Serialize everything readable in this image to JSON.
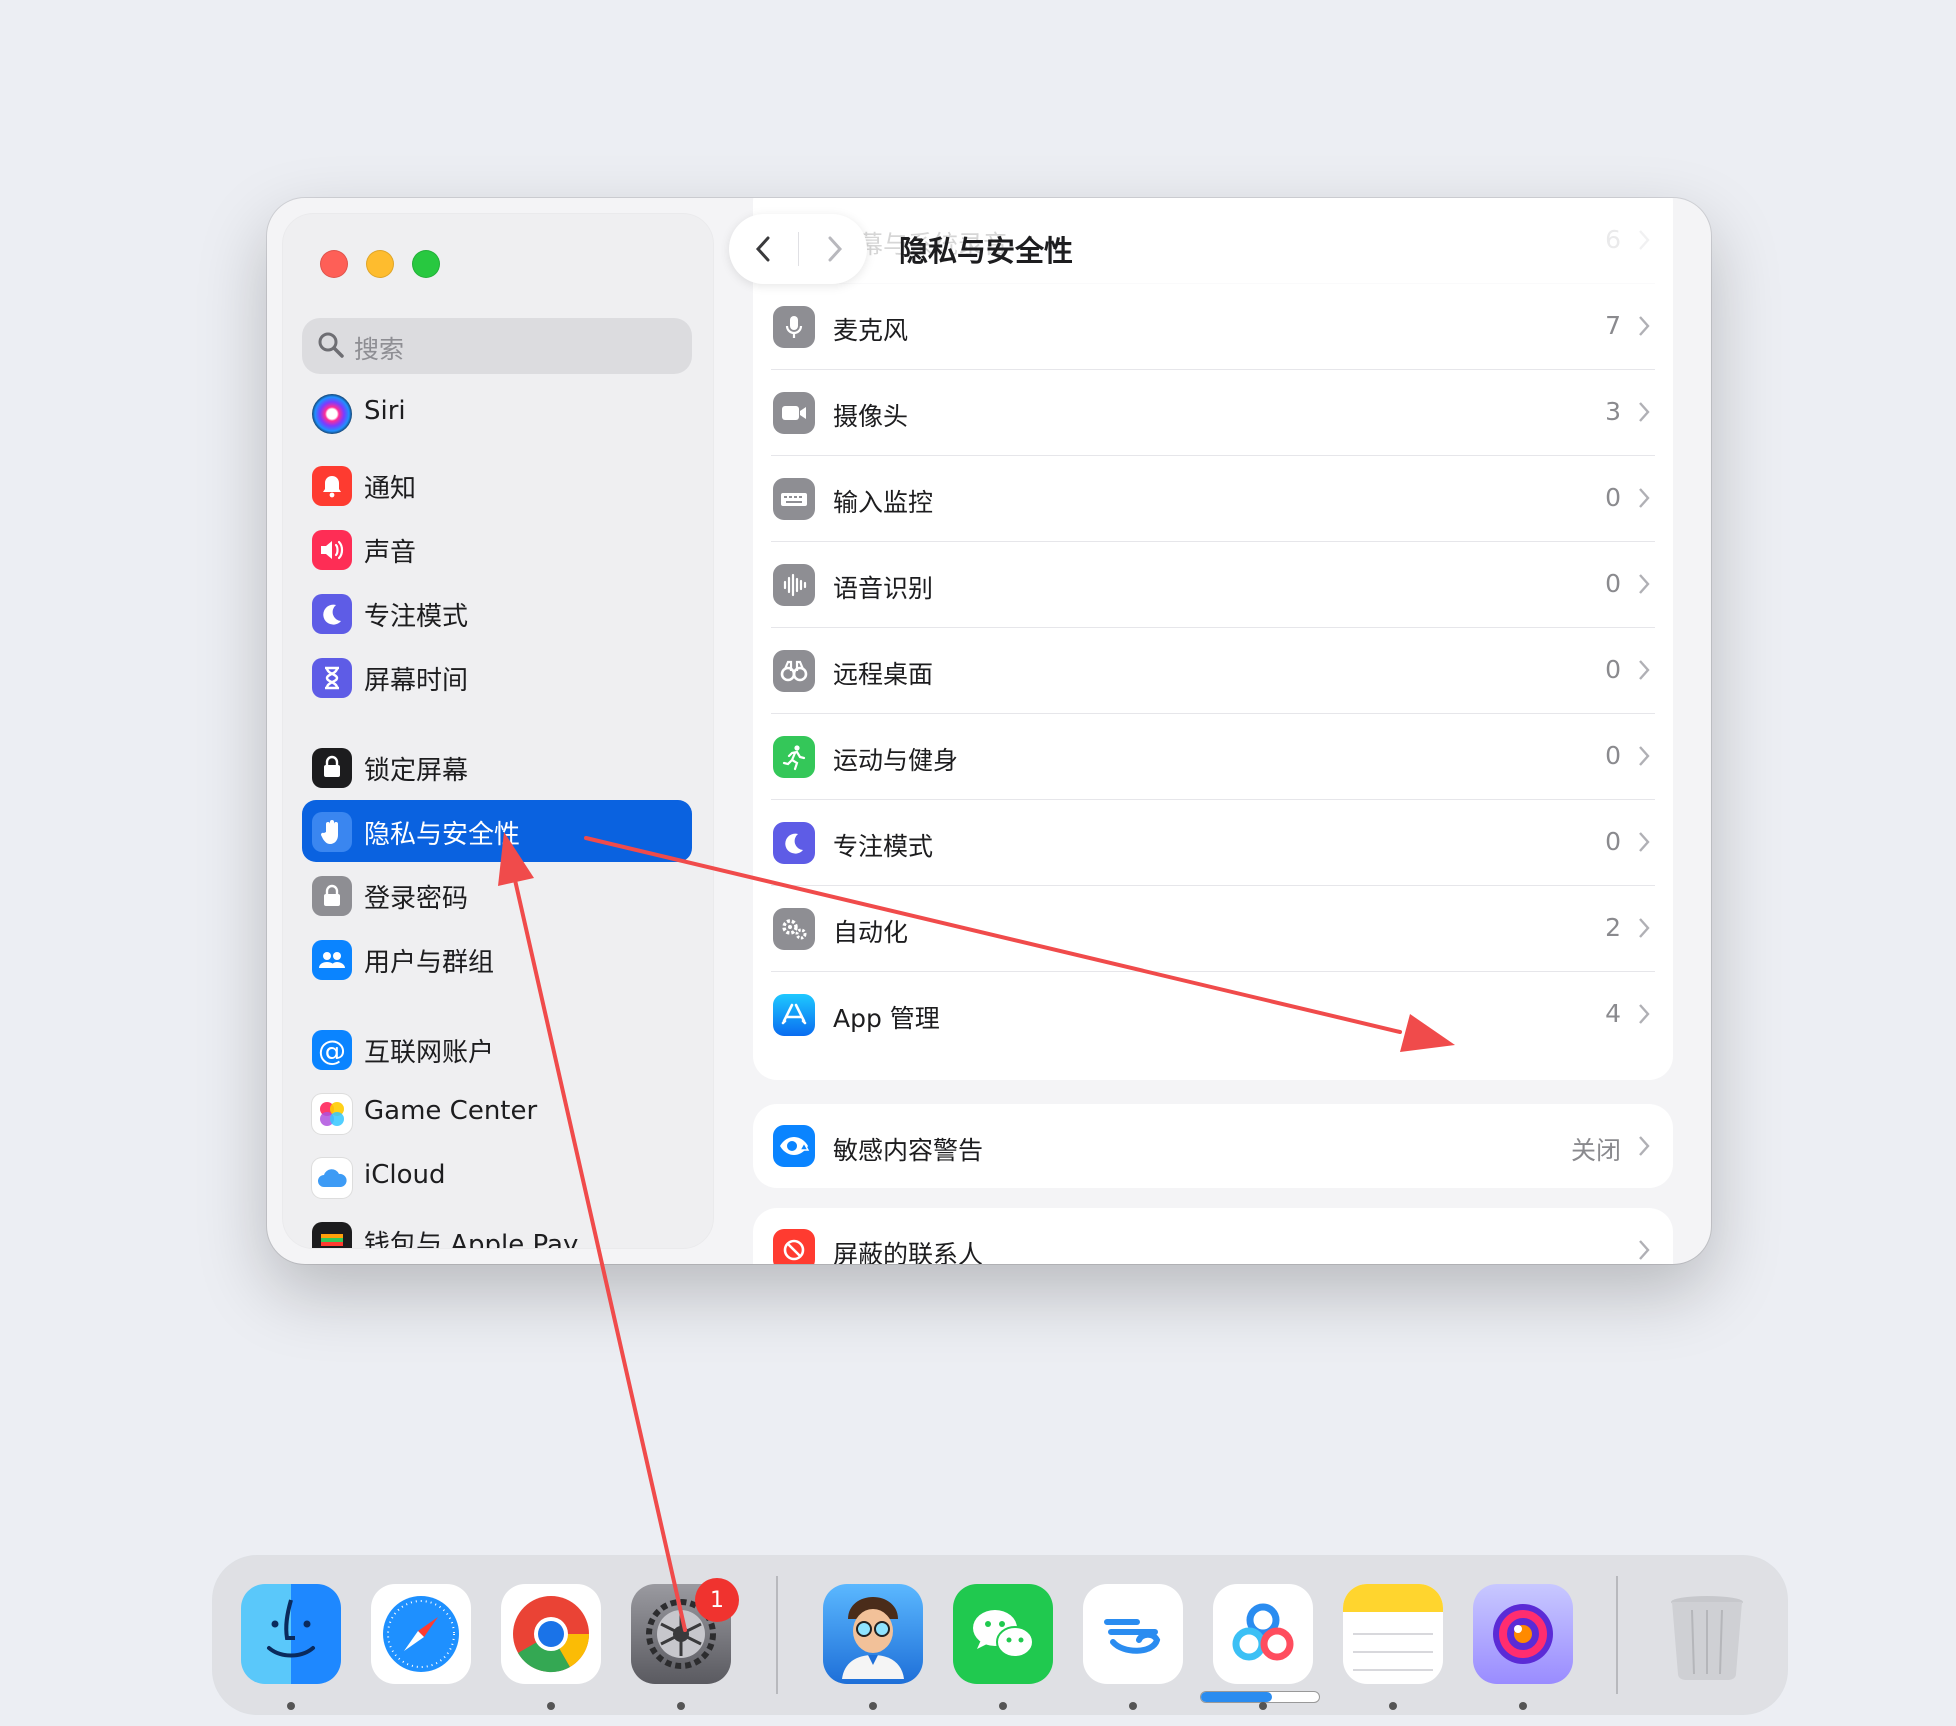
{
  "window": {
    "title": "隐私与安全性",
    "search_placeholder": "搜索",
    "sidebar": [
      {
        "id": "siri",
        "label": "Siri",
        "icon": "siri-icon"
      },
      {
        "id": "notifications",
        "label": "通知",
        "icon": "bell-icon",
        "color": "#fe3b30"
      },
      {
        "id": "sound",
        "label": "声音",
        "icon": "speaker-icon",
        "color": "#fe2d55"
      },
      {
        "id": "focus",
        "label": "专注模式",
        "icon": "moon-icon",
        "color": "#5e5ce6"
      },
      {
        "id": "screentime",
        "label": "屏幕时间",
        "icon": "hourglass-icon",
        "color": "#5e5ce6"
      },
      {
        "id": "lockscreen",
        "label": "锁定屏幕",
        "icon": "lock-screen-icon",
        "color": "#1c1c1e"
      },
      {
        "id": "privacy",
        "label": "隐私与安全性",
        "icon": "hand-icon",
        "color": "#0a62e0",
        "selected": true
      },
      {
        "id": "passwords",
        "label": "登录密码",
        "icon": "lock-icon",
        "color": "#8e8e93"
      },
      {
        "id": "users",
        "label": "用户与群组",
        "icon": "users-icon",
        "color": "#0a84ff"
      },
      {
        "id": "internet",
        "label": "互联网账户",
        "icon": "at-icon",
        "color": "#0a84ff"
      },
      {
        "id": "gamecenter",
        "label": "Game Center",
        "icon": "game-center-icon"
      },
      {
        "id": "icloud",
        "label": "iCloud",
        "icon": "cloud-icon"
      },
      {
        "id": "wallet",
        "label": "钱包与 Apple Pay",
        "icon": "wallet-icon",
        "color": "#1c1c1e"
      }
    ],
    "privacy_rows": [
      {
        "label": "屏幕与系统录音",
        "value": "6",
        "icon": "screen-record-icon"
      },
      {
        "label": "麦克风",
        "value": "7",
        "icon": "microphone-icon"
      },
      {
        "label": "摄像头",
        "value": "3",
        "icon": "camera-icon"
      },
      {
        "label": "输入监控",
        "value": "0",
        "icon": "keyboard-icon"
      },
      {
        "label": "语音识别",
        "value": "0",
        "icon": "waveform-icon"
      },
      {
        "label": "远程桌面",
        "value": "0",
        "icon": "binoculars-icon"
      },
      {
        "label": "运动与健身",
        "value": "0",
        "icon": "running-icon",
        "color": "#34c759"
      },
      {
        "label": "专注模式",
        "value": "0",
        "icon": "moon-icon",
        "color": "#5e5ce6"
      },
      {
        "label": "自动化",
        "value": "2",
        "icon": "gears-icon"
      },
      {
        "label": "App 管理",
        "value": "4",
        "icon": "app-store-icon",
        "color": "#0a84ff"
      }
    ],
    "sensitive": {
      "label": "敏感内容警告",
      "value": "关闭",
      "icon": "eye-warning-icon"
    },
    "blocked": {
      "label": "屏蔽的联系人",
      "icon": "blocked-icon"
    }
  },
  "dock": {
    "badge": "1",
    "apps": [
      "finder",
      "safari",
      "chrome",
      "system-settings",
      "avatar-app",
      "wechat",
      "cloud-app",
      "baidu-netdisk",
      "notes",
      "orbit-app",
      "trash"
    ]
  },
  "colors": {
    "accent": "#0a62e0",
    "annotation": "#f04b4b"
  }
}
